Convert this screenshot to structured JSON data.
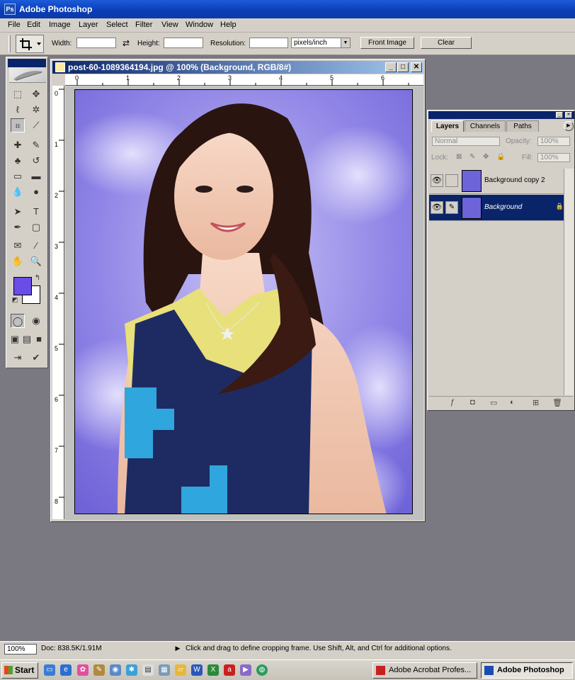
{
  "app": {
    "title": "Adobe Photoshop"
  },
  "menu": [
    "File",
    "Edit",
    "Image",
    "Layer",
    "Select",
    "Filter",
    "View",
    "Window",
    "Help"
  ],
  "options": {
    "width_label": "Width:",
    "width_value": "",
    "height_label": "Height:",
    "height_value": "",
    "resolution_label": "Resolution:",
    "resolution_value": "",
    "units": "pixels/inch",
    "front_image": "Front Image",
    "clear": "Clear"
  },
  "document": {
    "title": "post-60-1089364194.jpg @ 100% (Background, RGB/8#)",
    "ruler_h": [
      "0",
      "1",
      "2",
      "3",
      "4",
      "5",
      "6"
    ],
    "ruler_v": [
      "0",
      "1",
      "2",
      "3",
      "4",
      "5",
      "6",
      "7",
      "8"
    ]
  },
  "colors": {
    "foreground": "#6a4de6",
    "background": "#ffffff",
    "selection": "#0a246a"
  },
  "layers_panel": {
    "tabs": [
      "Layers",
      "Channels",
      "Paths"
    ],
    "blend_mode": "Normal",
    "opacity_label": "Opacity:",
    "opacity_value": "100%",
    "lock_label": "Lock:",
    "fill_label": "Fill:",
    "fill_value": "100%",
    "layers": [
      {
        "name": "Background copy 2",
        "visible": true,
        "active": false
      },
      {
        "name": "Background",
        "visible": true,
        "active": true,
        "locked": true
      }
    ]
  },
  "status": {
    "zoom": "100%",
    "doc_size": "Doc: 838.5K/1.91M",
    "message": "Click and drag to define cropping frame. Use Shift, Alt, and Ctrl for additional options."
  },
  "taskbar": {
    "start": "Start",
    "tasks": [
      {
        "label": "Adobe Acrobat Profes...",
        "active": false
      },
      {
        "label": "Adobe Photoshop",
        "active": true
      }
    ]
  }
}
